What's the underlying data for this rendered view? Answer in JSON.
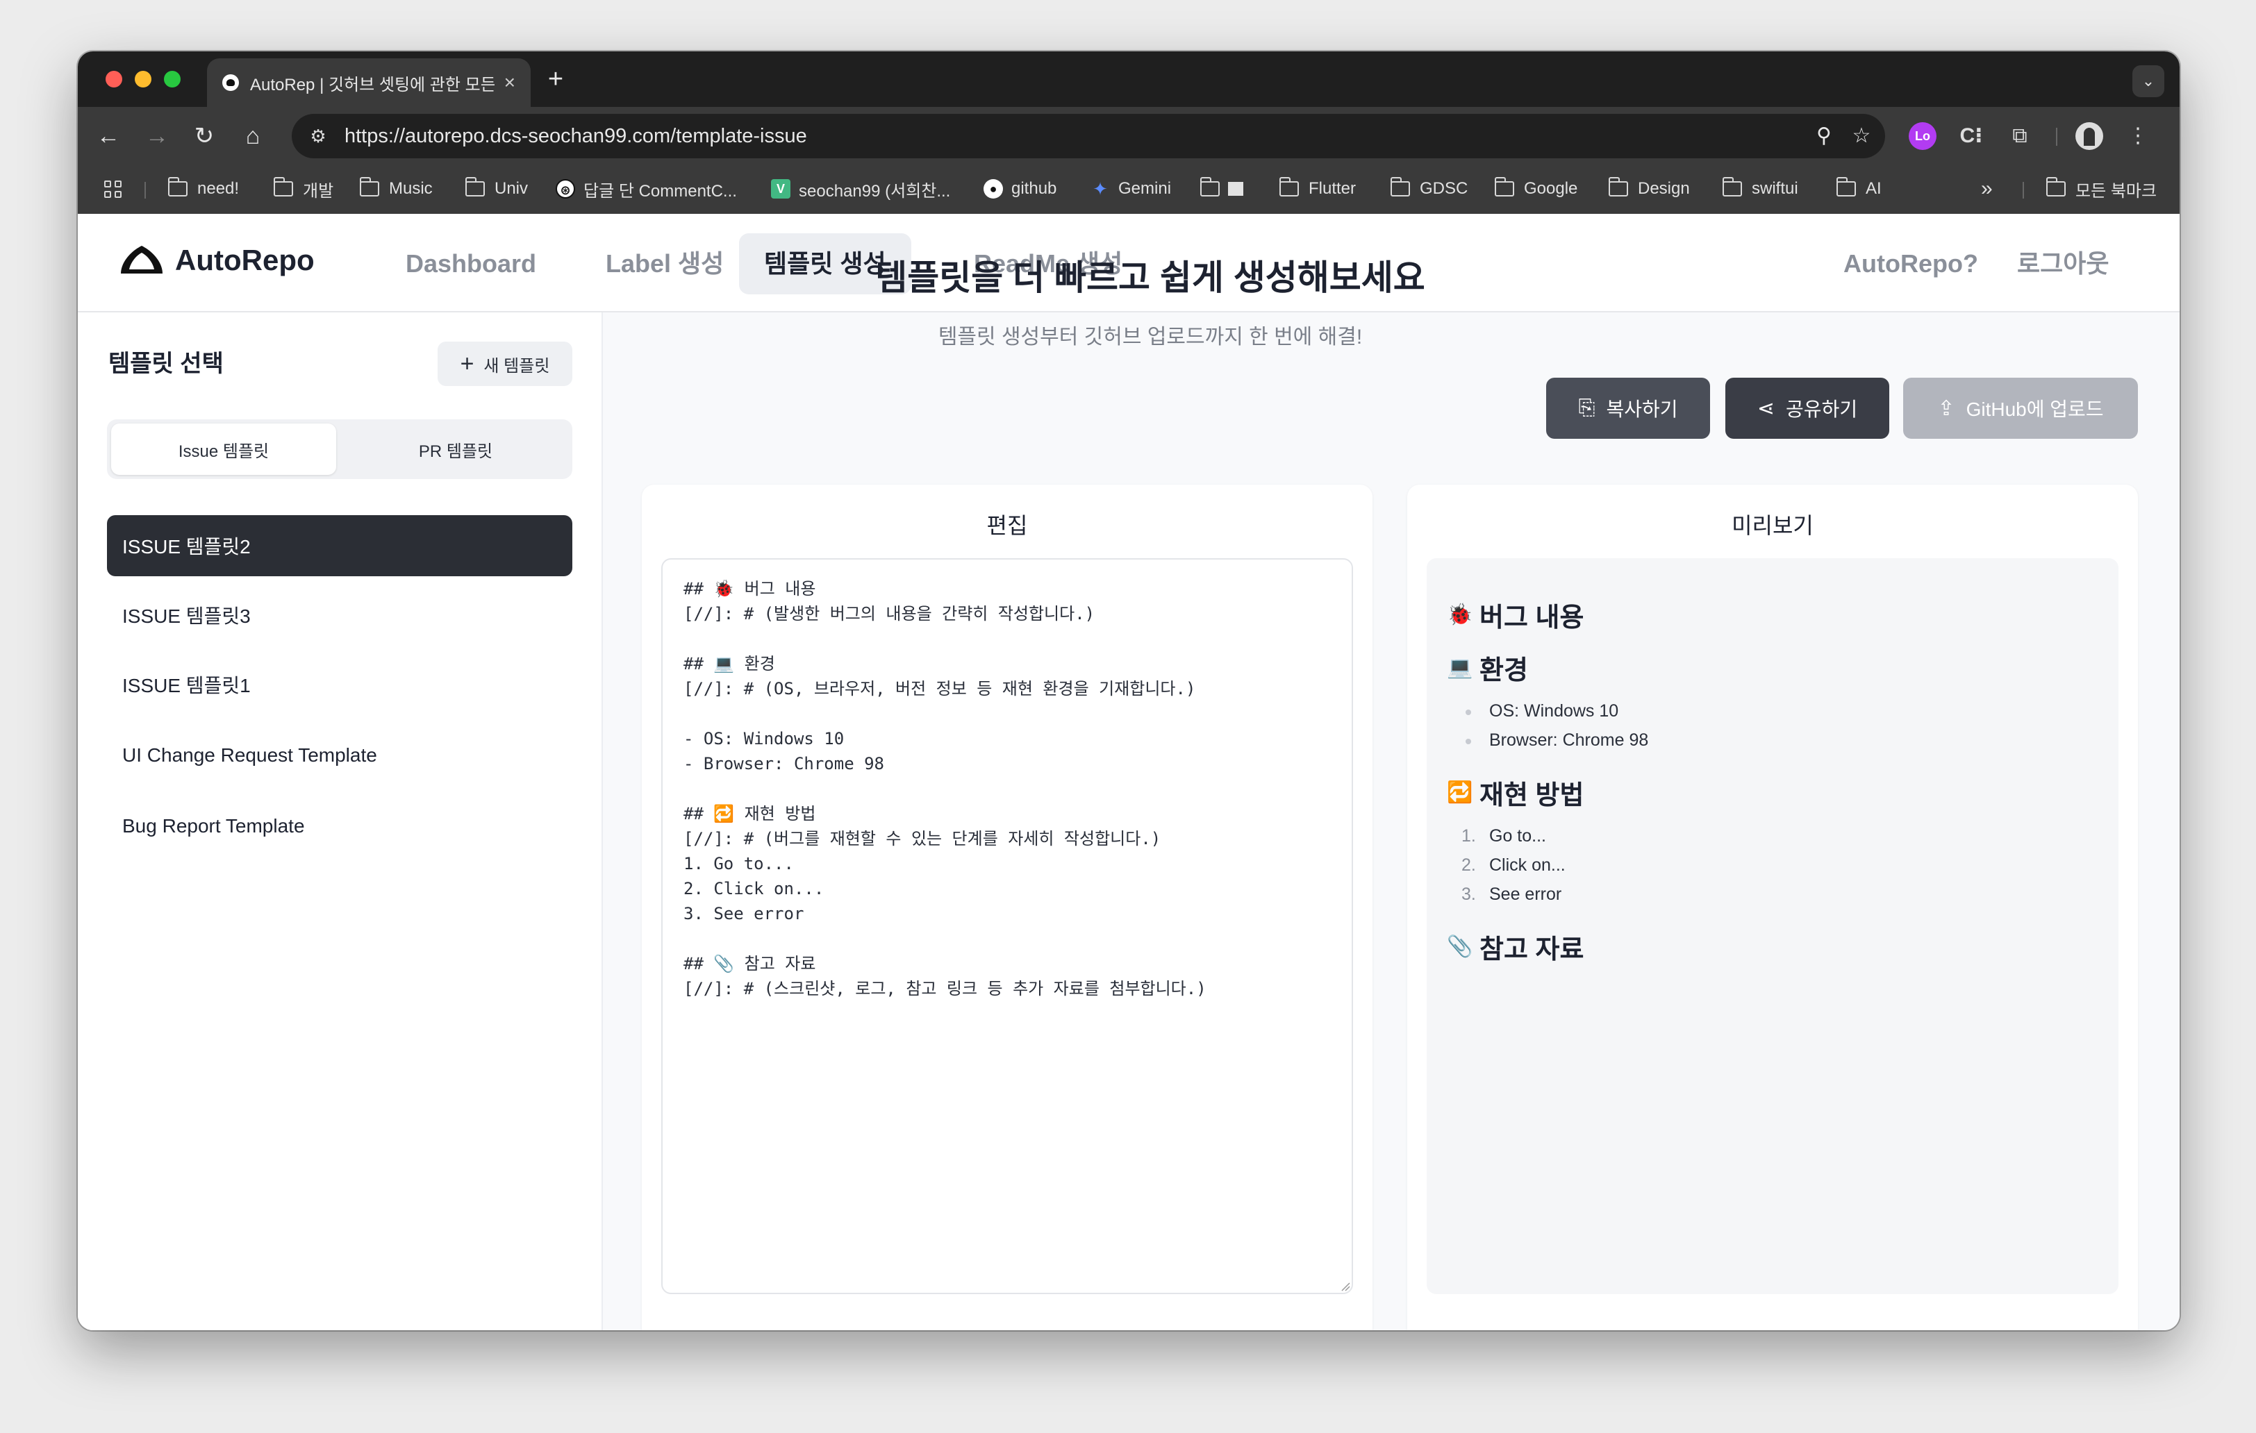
{
  "browser": {
    "tab_title": "AutoRep | 깃허브 셋팅에 관한 모든",
    "url": "https://autorepo.dcs-seochan99.com/template-issue",
    "bookmarks": [
      {
        "label": "need!",
        "kind": "folder"
      },
      {
        "label": "개발",
        "kind": "folder"
      },
      {
        "label": "Music",
        "kind": "folder"
      },
      {
        "label": "Univ",
        "kind": "folder"
      },
      {
        "label": "답글 단 CommentC...",
        "kind": "chatgpt"
      },
      {
        "label": "seochan99 (서희찬...",
        "kind": "vue"
      },
      {
        "label": "github",
        "kind": "github"
      },
      {
        "label": "Gemini",
        "kind": "gemini"
      },
      {
        "label": "",
        "kind": "folder"
      },
      {
        "label": "Flutter",
        "kind": "folder"
      },
      {
        "label": "GDSC",
        "kind": "folder"
      },
      {
        "label": "Google",
        "kind": "folder"
      },
      {
        "label": "Design",
        "kind": "folder"
      },
      {
        "label": "swiftui",
        "kind": "folder"
      },
      {
        "label": "AI",
        "kind": "folder"
      }
    ],
    "more_bookmarks": "»",
    "all_bookmarks": "모든 북마크"
  },
  "nav": {
    "brand": "AutoRepo",
    "links": [
      "Dashboard",
      "Label 생성",
      "템플릿 생성",
      "ReadMe 생성"
    ],
    "active_link": 2,
    "about": "AutoRepo?",
    "logout": "로그아웃"
  },
  "sidebar": {
    "title": "템플릿 선택",
    "new_button": "새 템플릿",
    "segments": [
      "Issue 템플릿",
      "PR 템플릿"
    ],
    "active_segment": 0,
    "templates": [
      "ISSUE 템플릿2",
      "ISSUE 템플릿3",
      "ISSUE 템플릿1",
      "UI Change Request Template",
      "Bug Report Template"
    ],
    "active_template": 0
  },
  "main": {
    "title": "템플릿을 더 빠르고 쉽게 생성해보세요",
    "subtitle": "템플릿 생성부터 깃허브 업로드까지 한 번에 해결!",
    "copy_button": "복사하기",
    "share_button": "공유하기",
    "upload_button": "GitHub에 업로드"
  },
  "editor": {
    "title": "편집",
    "content": "## 🐞 버그 내용\n[//]: # (발생한 버그의 내용을 간략히 작성합니다.)\n\n## 💻 환경\n[//]: # (OS, 브라우저, 버전 정보 등 재현 환경을 기재합니다.)\n\n- OS: Windows 10\n- Browser: Chrome 98\n\n## 🔁 재현 방법\n[//]: # (버그를 재현할 수 있는 단계를 자세히 작성합니다.)\n1. Go to...\n2. Click on...\n3. See error\n\n## 📎 참고 자료\n[//]: # (스크린샷, 로그, 참고 링크 등 추가 자료를 첨부합니다.)"
  },
  "preview": {
    "title": "미리보기",
    "sections": [
      {
        "emoji": "🐞",
        "heading": "버그 내용"
      },
      {
        "emoji": "💻",
        "heading": "환경",
        "bullets": [
          "OS: Windows 10",
          "Browser: Chrome 98"
        ]
      },
      {
        "emoji": "🔁",
        "heading": "재현 방법",
        "steps": [
          "Go to...",
          "Click on...",
          "See error"
        ]
      },
      {
        "emoji": "📎",
        "heading": "참고 자료"
      }
    ]
  }
}
